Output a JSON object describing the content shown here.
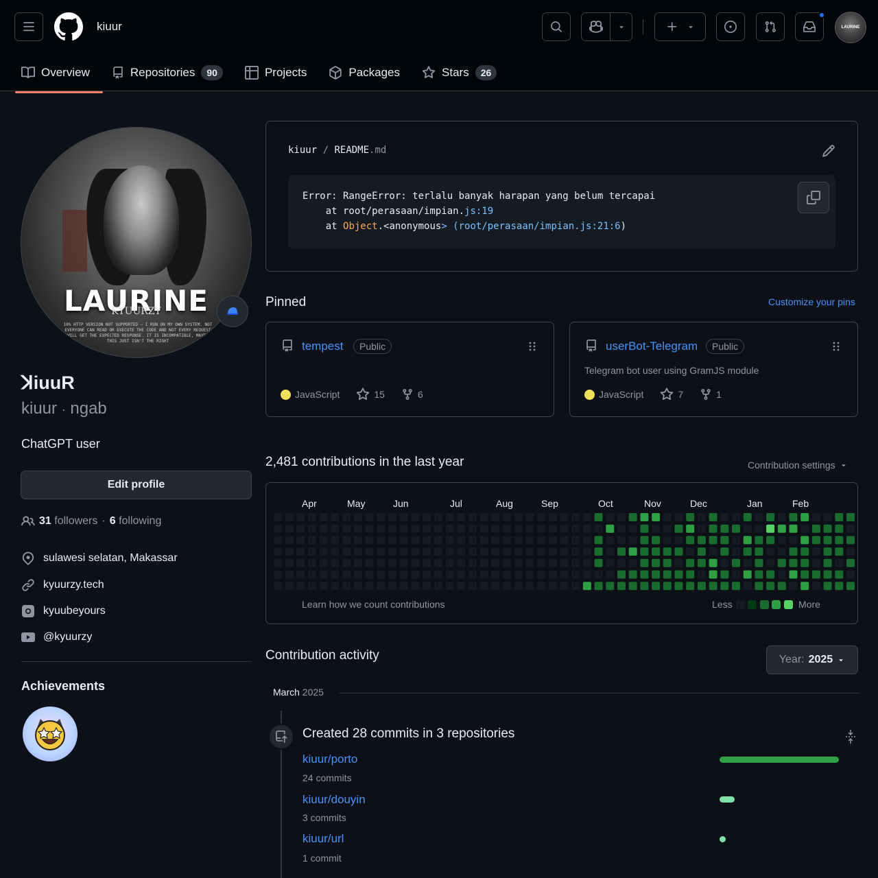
{
  "header": {
    "username": "kiuur",
    "avatar_text": "LAURINE"
  },
  "tabs": [
    {
      "label": "Overview",
      "count": null
    },
    {
      "label": "Repositories",
      "count": "90"
    },
    {
      "label": "Projects",
      "count": null
    },
    {
      "label": "Packages",
      "count": null
    },
    {
      "label": "Stars",
      "count": "26"
    }
  ],
  "profile": {
    "avatar_title": "LAURINE",
    "avatar_subtitle": "KYUURZY",
    "avatar_fineprint": "10% HTTP VERSION NOT SUPPORTED — I RUN ON MY OWN SYSTEM. NOT EVERYONE CAN READ OR EXECUTE THE CODE AND NOT EVERY REQUEST WILL GET THE EXPECTED RESPONSE. IT IS INCOMPATIBLE, MAYBE THIS JUST ISN'T THE RIGHT",
    "display_name": "ꓘiuuR",
    "login": "kiuur",
    "pronoun_sep": "·",
    "pronouns": "ngab",
    "bio": "ChatGPT user",
    "edit_label": "Edit profile",
    "followers": "31",
    "followers_label": "followers",
    "following": "6",
    "following_label": "following",
    "location": "sulawesi selatan, Makassar",
    "website": "kyuurzy.tech",
    "instagram": "kyuubeyours",
    "youtube": "@kyuurzy",
    "achievements_title": "Achievements"
  },
  "readme": {
    "owner": "kiuur",
    "slash": "/",
    "file": "README",
    "ext": ".md",
    "code_line1": "Error: RangeError: terlalu banyak harapan yang belum tercapai",
    "code_line2_a": "    at root/perasaan/impian.",
    "code_line2_b": "js:19",
    "code_line3_a": "    at ",
    "code_line3_b": "Object",
    "code_line3_c": ".<anonymous",
    "code_line3_d": "> (root/perasaan/impian.",
    "code_line3_e": "js:21:6",
    "code_line3_f": ")"
  },
  "pinned": {
    "title": "Pinned",
    "customize": "Customize your pins",
    "repos": [
      {
        "name": "tempest",
        "visibility": "Public",
        "description": "",
        "language": "JavaScript",
        "stars": "15",
        "forks": "6"
      },
      {
        "name": "userBot-Telegram",
        "visibility": "Public",
        "description": "Telegram bot user using GramJS module",
        "language": "JavaScript",
        "stars": "7",
        "forks": "1"
      }
    ]
  },
  "contributions": {
    "title": "2,481 contributions in the last year",
    "settings": "Contribution settings",
    "months": [
      "Apr",
      "May",
      "Jun",
      "Jul",
      "Aug",
      "Sep",
      "Oct",
      "Nov",
      "Dec",
      "Jan",
      "Feb"
    ],
    "learn": "Learn how we count contributions",
    "less": "Less",
    "more": "More",
    "colors": {
      "0": "#151b23",
      "1": "#033a16",
      "2": "#196c2e",
      "3": "#2ea043",
      "4": "#56d364"
    },
    "levels": [
      "00000000000000000000000000002002330020200202023002222000",
      "00000000000000000000000000000300200230222004330222002200",
      "00000000000000000000000000002000220022220322003222220322",
      "00000000000000000000000000002023222202020220022022020002",
      "00000000000000000000000000002000222022302020222020220000",
      "00000000000000000000000000000022222220320322032222022000",
      "000000000000000000000000000322222222222220222030222220000"
    ]
  },
  "activity": {
    "title": "Contribution activity",
    "year_label": "Year:",
    "year": "2025",
    "month": "March",
    "month_year": "2025",
    "summary": "Created 28 commits in 3 repositories",
    "repos": [
      {
        "name": "kiuur/porto",
        "commits": "24 commits",
        "fraction": 1.0,
        "color": "#2ea043"
      },
      {
        "name": "kiuur/douyin",
        "commits": "3 commits",
        "fraction": 0.125,
        "color": "#7ee2a8"
      },
      {
        "name": "kiuur/url",
        "commits": "1 commit",
        "fraction": 0.04,
        "color": "#7ee2a8"
      }
    ]
  }
}
